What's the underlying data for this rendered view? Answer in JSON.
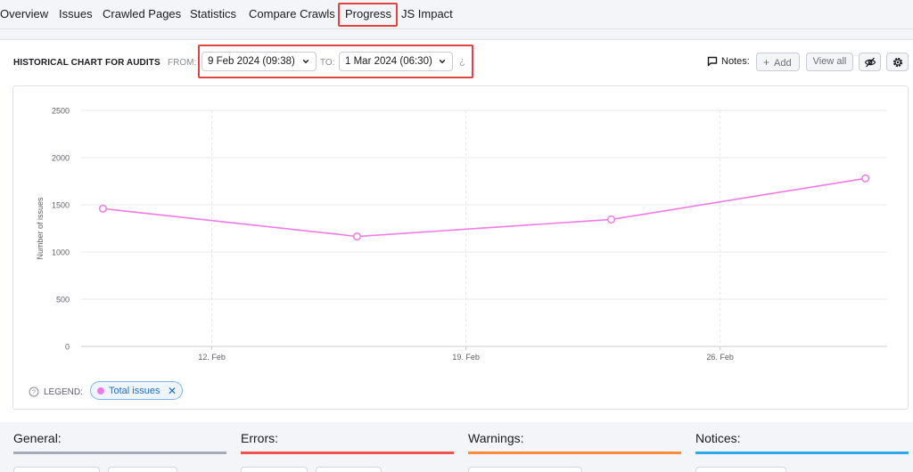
{
  "nav": {
    "tabs": [
      {
        "label": "Overview"
      },
      {
        "label": "Issues"
      },
      {
        "label": "Crawled Pages"
      },
      {
        "label": "Statistics"
      },
      {
        "label": "Compare Crawls"
      },
      {
        "label": "Progress",
        "active": true
      },
      {
        "label": "JS Impact"
      }
    ]
  },
  "header": {
    "title": "HISTORICAL CHART FOR AUDITS",
    "from_label": "FROM:",
    "from_value": "9 Feb 2024 (09:38)",
    "to_label": "TO:",
    "to_value": "1 Mar 2024 (06:30)",
    "truncated_more": "¿"
  },
  "notes": {
    "label": "Notes:",
    "add_label": "Add",
    "view_all_label": "View all",
    "hide_icon": "eye-slash-icon",
    "settings_icon": "gear-icon"
  },
  "chart_data": {
    "type": "line",
    "ylabel": "Number of issues",
    "ylim": [
      0,
      2500
    ],
    "yticks": [
      0,
      500,
      1000,
      1500,
      2000,
      2500
    ],
    "xticks": [
      "12. Feb",
      "19. Feb",
      "26. Feb"
    ],
    "series": [
      {
        "name": "Total issues",
        "color": "#f07ae8",
        "points": [
          {
            "x": "2024-02-09",
            "y": 1460
          },
          {
            "x": "2024-02-16",
            "y": 1165
          },
          {
            "x": "2024-02-23",
            "y": 1345
          },
          {
            "x": "2024-03-01",
            "y": 1780
          }
        ]
      }
    ],
    "grid": true
  },
  "legend": {
    "label": "LEGEND:",
    "items": [
      {
        "label": "Total issues",
        "color": "#f07ae8"
      }
    ]
  },
  "sections": [
    {
      "label": "General:",
      "color": "#a7a9b4"
    },
    {
      "label": "Errors:",
      "color": "#f0524f"
    },
    {
      "label": "Warnings:",
      "color": "#ff8c3a"
    },
    {
      "label": "Notices:",
      "color": "#2ea8ea"
    }
  ]
}
